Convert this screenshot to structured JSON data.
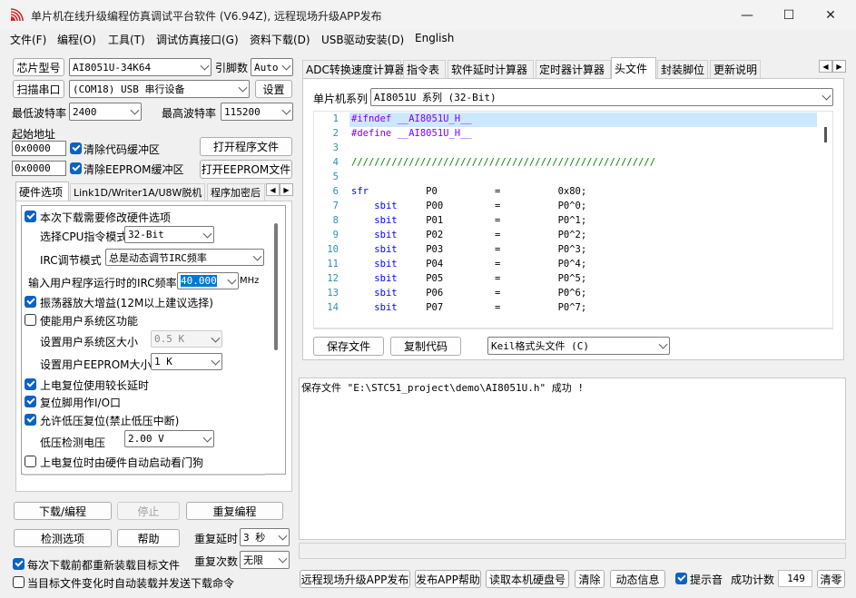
{
  "window": {
    "title": "单片机在线升级编程仿真调试平台软件 (V6.94Z), 远程现场升级APP发布",
    "minimize": "—",
    "maximize": "☐",
    "close": "✕"
  },
  "menu": [
    "文件(F)",
    "编程(O)",
    "工具(T)",
    "调试仿真接口(G)",
    "资料下载(D)",
    "USB驱动安装(D)",
    "English"
  ],
  "left": {
    "chip_type_btn": "芯片型号",
    "chip_type_value": "AI8051U-34K64",
    "pin_count_label": "引脚数",
    "pin_count_value": "Auto",
    "scan_port_btn": "扫描串口",
    "port_value": "(COM18) USB 串行设备",
    "settings_btn": "设置",
    "min_baud_label": "最低波特率",
    "min_baud_value": "2400",
    "max_baud_label": "最高波特率",
    "max_baud_value": "115200",
    "start_addr_label": "起始地址",
    "addr1": "0x0000",
    "clear_code_buffer": "清除代码缓冲区",
    "open_prog_file": "打开程序文件",
    "addr2": "0x0000",
    "clear_eeprom_buffer": "清除EEPROM缓冲区",
    "open_eeprom_file": "打开EEPROM文件",
    "tabs": [
      "硬件选项",
      "Link1D/Writer1A/U8W脱机",
      "程序加密后"
    ],
    "hw": {
      "modify_hw_options": "本次下载需要修改硬件选项",
      "cpu_instr_label": "选择CPU指令模式",
      "cpu_instr_value": "32-Bit",
      "irc_mode_label": "IRC调节模式",
      "irc_mode_value": "总是动态调节IRC频率",
      "irc_freq_label": "输入用户程序运行时的IRC频率",
      "irc_freq_value": "40.000",
      "irc_freq_unit": "MHz",
      "osc_gain": "振荡器放大增益(12M以上建议选择)",
      "user_sys_area": "使能用户系统区功能",
      "sys_area_size_label": "设置用户系统区大小",
      "sys_area_size_value": "0.5 K",
      "eeprom_size_label": "设置用户EEPROM大小",
      "eeprom_size_value": "1   K",
      "power_on_delay": "上电复位使用较长延时",
      "reset_pin_io": "复位脚用作I/O口",
      "low_volt_reset": "允许低压复位(禁止低压中断)",
      "low_volt_label": "低压检测电压",
      "low_volt_value": "2.00 V",
      "watchdog": "上电复位时由硬件自动启动看门狗"
    },
    "download_btn": "下载/编程",
    "stop_btn": "停止",
    "reprog_btn": "重复编程",
    "check_options_btn": "检测选项",
    "help_btn": "帮助",
    "repeat_delay_label": "重复延时",
    "repeat_delay_value": "3 秒",
    "repeat_count_label": "重复次数",
    "repeat_count_value": "无限",
    "reload_before_download": "每次下载前都重新装载目标文件",
    "auto_reload": "当目标文件变化时自动装载并发送下载命令"
  },
  "right": {
    "tabs": [
      "ADC转换速度计算器",
      "指令表",
      "软件延时计算器",
      "定时器计算器",
      "头文件",
      "封装脚位",
      "更新说明"
    ],
    "mcu_series_label": "单片机系列",
    "mcu_series_value": "AI8051U 系列 (32-Bit)",
    "code_lines": [
      {
        "n": "1",
        "t": "#ifndef __AI8051U_H__"
      },
      {
        "n": "2",
        "t": "#define __AI8051U_H__"
      },
      {
        "n": "3",
        "t": ""
      },
      {
        "n": "4",
        "t": "/////////////////////////////////////////////////////"
      },
      {
        "n": "5",
        "t": ""
      },
      {
        "n": "6",
        "t": "sfr          P0          =          0x80;"
      },
      {
        "n": "7",
        "t": "    sbit     P00         =          P0^0;"
      },
      {
        "n": "8",
        "t": "    sbit     P01         =          P0^1;"
      },
      {
        "n": "9",
        "t": "    sbit     P02         =          P0^2;"
      },
      {
        "n": "10",
        "t": "    sbit     P03         =          P0^3;"
      },
      {
        "n": "11",
        "t": "    sbit     P04         =          P0^4;"
      },
      {
        "n": "12",
        "t": "    sbit     P05         =          P0^5;"
      },
      {
        "n": "13",
        "t": "    sbit     P06         =          P0^6;"
      },
      {
        "n": "14",
        "t": "    sbit     P07         =          P0^7;"
      }
    ],
    "save_file_btn": "保存文件",
    "copy_code_btn": "复制代码",
    "header_format_value": "Keil格式头文件 (C)",
    "log": "保存文件 \"E:\\STC51_project\\demo\\AI8051U.h\" 成功 !",
    "bottom": {
      "publish_app_btn": "远程现场升级APP发布",
      "publish_help_btn": "发布APP帮助",
      "read_disk_btn": "读取本机硬盘号",
      "clear_btn": "清除",
      "dynamic_info_btn": "动态信息",
      "beep_label": "提示音",
      "success_count_label": "成功计数",
      "success_count_value": "149",
      "reset_btn": "清零"
    }
  },
  "colors": {
    "accent": "#0a62c2",
    "selection": "#cce8ff",
    "code_keyword": "#0000ff",
    "code_directive": "#8000ff",
    "line_number": "#2b91af",
    "comment": "#008000"
  }
}
